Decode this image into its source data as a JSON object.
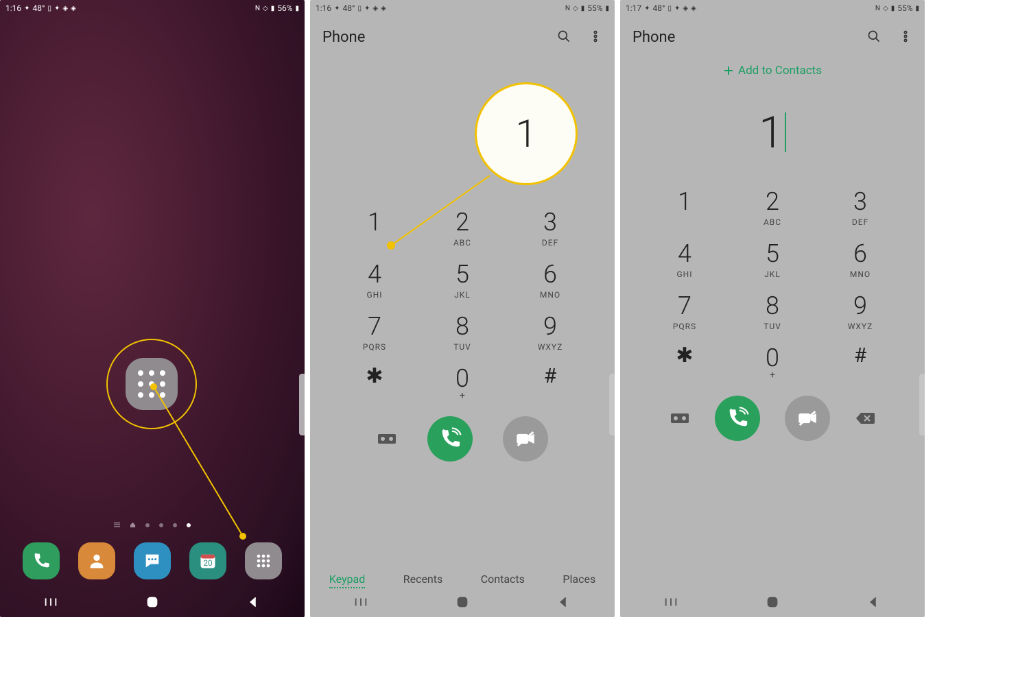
{
  "screen1": {
    "status_time": "1:16",
    "status_temp": "48°",
    "status_batt": "56%",
    "calendar_day": "20"
  },
  "screen2": {
    "status_time": "1:16",
    "status_temp": "48°",
    "status_batt": "55%",
    "app_title": "Phone",
    "zoom_value": "1",
    "keys": {
      "1": {
        "num": "1",
        "let": ""
      },
      "2": {
        "num": "2",
        "let": "ABC"
      },
      "3": {
        "num": "3",
        "let": "DEF"
      },
      "4": {
        "num": "4",
        "let": "GHI"
      },
      "5": {
        "num": "5",
        "let": "JKL"
      },
      "6": {
        "num": "6",
        "let": "MNO"
      },
      "7": {
        "num": "7",
        "let": "PQRS"
      },
      "8": {
        "num": "8",
        "let": "TUV"
      },
      "9": {
        "num": "9",
        "let": "WXYZ"
      },
      "star": "✱",
      "0": {
        "num": "0",
        "let": "+"
      },
      "hash": "#"
    },
    "tabs": {
      "keypad": "Keypad",
      "recents": "Recents",
      "contacts": "Contacts",
      "places": "Places"
    }
  },
  "screen3": {
    "status_time": "1:17",
    "status_temp": "48°",
    "status_batt": "55%",
    "app_title": "Phone",
    "add_contacts": "Add to Contacts",
    "entered": "1",
    "keys": {
      "1": {
        "num": "1",
        "let": ""
      },
      "2": {
        "num": "2",
        "let": "ABC"
      },
      "3": {
        "num": "3",
        "let": "DEF"
      },
      "4": {
        "num": "4",
        "let": "GHI"
      },
      "5": {
        "num": "5",
        "let": "JKL"
      },
      "6": {
        "num": "6",
        "let": "MNO"
      },
      "7": {
        "num": "7",
        "let": "PQRS"
      },
      "8": {
        "num": "8",
        "let": "TUV"
      },
      "9": {
        "num": "9",
        "let": "WXYZ"
      },
      "star": "✱",
      "0": {
        "num": "0",
        "let": "+"
      },
      "hash": "#"
    }
  }
}
